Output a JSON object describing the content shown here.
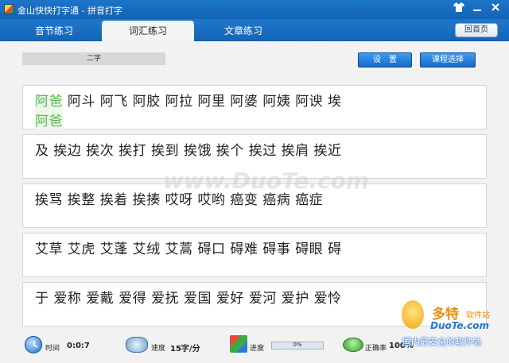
{
  "window": {
    "title": "金山快快打字通 - 拼音打字",
    "skin_icon": "shirt-icon",
    "minimize_icon": "minimize-icon",
    "close_icon": "close-icon"
  },
  "tabs": [
    {
      "label": "音节练习",
      "active": false
    },
    {
      "label": "词汇练习",
      "active": true
    },
    {
      "label": "文章练习",
      "active": false
    }
  ],
  "home_button": "回首页",
  "toolbar": {
    "level": "二字",
    "settings_label": "设　置",
    "course_label": "课程选择"
  },
  "practice": {
    "rows": [
      {
        "text_line": "阿爸 阿斗 阿飞 阿胶 阿拉 阿里 阿婆 阿姨 阿谀 埃",
        "typed_prefix": "阿爸",
        "input_line": "阿爸"
      },
      {
        "text_line": "及 挨边 挨次 挨打 挨到 挨饿 挨个 挨过 挨肩 挨近",
        "typed_prefix": "",
        "input_line": ""
      },
      {
        "text_line": " 挨骂 挨整 挨着 挨揍 哎呀 哎哟 癌变 癌病 癌症",
        "typed_prefix": "",
        "input_line": ""
      },
      {
        "text_line": "艾草 艾虎 艾蓬 艾绒 艾蒿 碍口 碍难 碍事 碍眼 碍",
        "typed_prefix": "",
        "input_line": ""
      },
      {
        "text_line": "于 爱称 爱戴 爱得 爱抚 爱国 爱好 爱河 爱护 爱怜",
        "typed_prefix": "",
        "input_line": ""
      }
    ]
  },
  "status": {
    "time_label": "时间",
    "time_value": "0:0:7",
    "speed_label": "速度",
    "speed_value": "15字/分",
    "progress_label": "进度",
    "progress_value": "0%",
    "progress_fraction": 0.0,
    "accuracy_label": "正确率",
    "accuracy_value": "100%"
  },
  "watermark": "www.DuoTe.com",
  "brand": {
    "name": "多特",
    "sub": "软件站",
    "domain": "DuoTe.com",
    "slogan": "国内最安全的软件站"
  },
  "colors": {
    "titlebar": "#1d75c9",
    "typed_text": "#58b957",
    "button": "#1d7bd8"
  }
}
